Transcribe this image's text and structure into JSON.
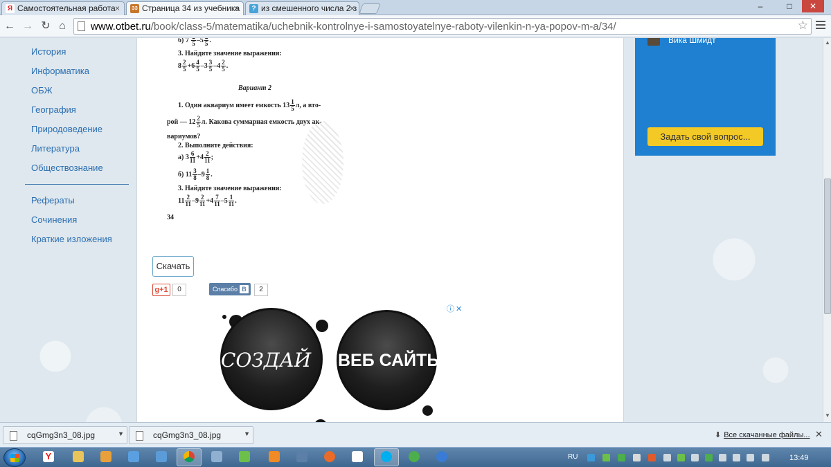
{
  "browser": {
    "tabs": [
      {
        "title": "Самостоятельная работа",
        "favicon": "Я"
      },
      {
        "title": "Страница 34 из учебника",
        "favicon": "ЗЗ"
      },
      {
        "title": "из смешенного числа 2 з",
        "favicon": "?"
      }
    ],
    "url_host": "www.otbet.ru",
    "url_path": "/book/class-5/matematika/uchebnik-kontrolnye-i-samostoyatelnye-raboty-vilenkin-n-ya-popov-m-a/34/",
    "window_controls": {
      "minimize": "–",
      "maximize": "□",
      "close": "✕"
    }
  },
  "sidebar": {
    "subjects": [
      "История",
      "Информатика",
      "ОБЖ",
      "География",
      "Природоведение",
      "Литература",
      "Обществознание"
    ],
    "extras": [
      "Рефераты",
      "Сочинения",
      "Краткие изложения"
    ]
  },
  "scan": {
    "line_b1": "б) 7",
    "task3": "3. Найдите значение выражения:",
    "expr1_prefix": "8",
    "variant": "Вариант 2",
    "task1_a": "1. Один аквариум имеет емкость 13",
    "task1_b": "л, а вто-",
    "task1_c": "рой — 12",
    "task1_d": "л. Какова суммарная емкость двух ак-",
    "task1_e": "вариумов?",
    "task2": "2. Выполните действия:",
    "a_prefix": "а) 3",
    "b_prefix": "б) 11",
    "task3b": "3. Найдите значение выражения:",
    "expr2_prefix": "11",
    "page_number": "34"
  },
  "actions": {
    "download_label": "Скачать",
    "gplus_label": "g+1",
    "gplus_count": "0",
    "thanks_label": "Спасибо",
    "thanks_count": "2"
  },
  "ad": {
    "left_text": "СОЗДАЙ",
    "right_text": "ВЕБ САЙТЫ",
    "info": "ⓘ",
    "close": "✕"
  },
  "right_widget": {
    "username": "Вика Шмидт",
    "ask_button": "Задать свой вопрос..."
  },
  "downloads": {
    "items": [
      "cqGmg3n3_08.jpg",
      "cqGmg3n3_08.jpg"
    ],
    "show_all": "Все скачанные файлы..."
  },
  "taskbar": {
    "lang": "RU",
    "time": "13:49"
  },
  "colors": {
    "link": "#2a6db0",
    "widget_bg": "#1f7fd0",
    "ask_button_bg": "#f3c925",
    "vk_blue": "#5b7fa6",
    "gplus_red": "#dd4b39"
  }
}
